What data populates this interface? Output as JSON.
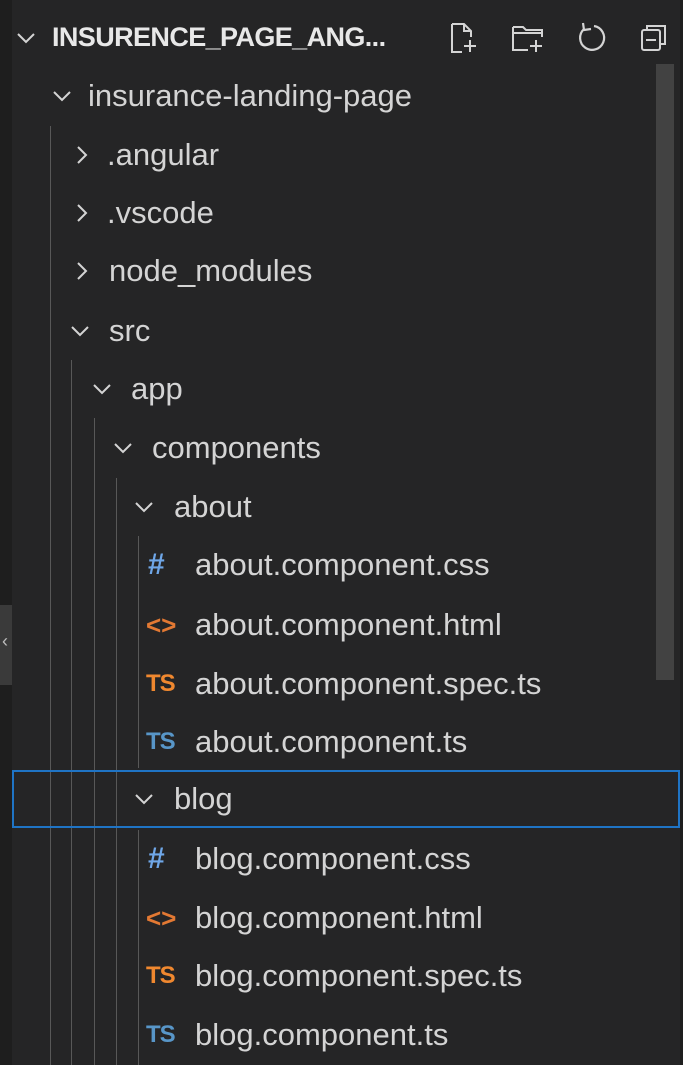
{
  "explorer": {
    "title": "INSURENCE_PAGE_ANG...",
    "actions": [
      {
        "name": "new-file-icon",
        "label": "New File"
      },
      {
        "name": "new-folder-icon",
        "label": "New Folder"
      },
      {
        "name": "refresh-icon",
        "label": "Refresh Explorer"
      },
      {
        "name": "collapse-all-icon",
        "label": "Collapse Folders in Explorer"
      }
    ]
  },
  "tree": {
    "root": "insurance-landing-page",
    "angular": ".angular",
    "vscode": ".vscode",
    "node_modules": "node_modules",
    "src": "src",
    "app": "app",
    "components": "components",
    "about": "about",
    "about_css": "about.component.css",
    "about_html": "about.component.html",
    "about_spec": "about.component.spec.ts",
    "about_ts": "about.component.ts",
    "blog": "blog",
    "blog_css": "blog.component.css",
    "blog_html": "blog.component.html",
    "blog_spec": "blog.component.spec.ts",
    "blog_ts": "blog.component.ts"
  },
  "icons": {
    "css_glyph": "#",
    "html_glyph": "<>",
    "ts_glyph": "TS"
  },
  "colors": {
    "background": "#252526",
    "text": "#d4d4d4",
    "selection_border": "#1f74c5",
    "css_icon": "#6fa7e8",
    "html_icon": "#e37933",
    "spec_icon": "#f0882f",
    "ts_icon": "#5896c8"
  }
}
